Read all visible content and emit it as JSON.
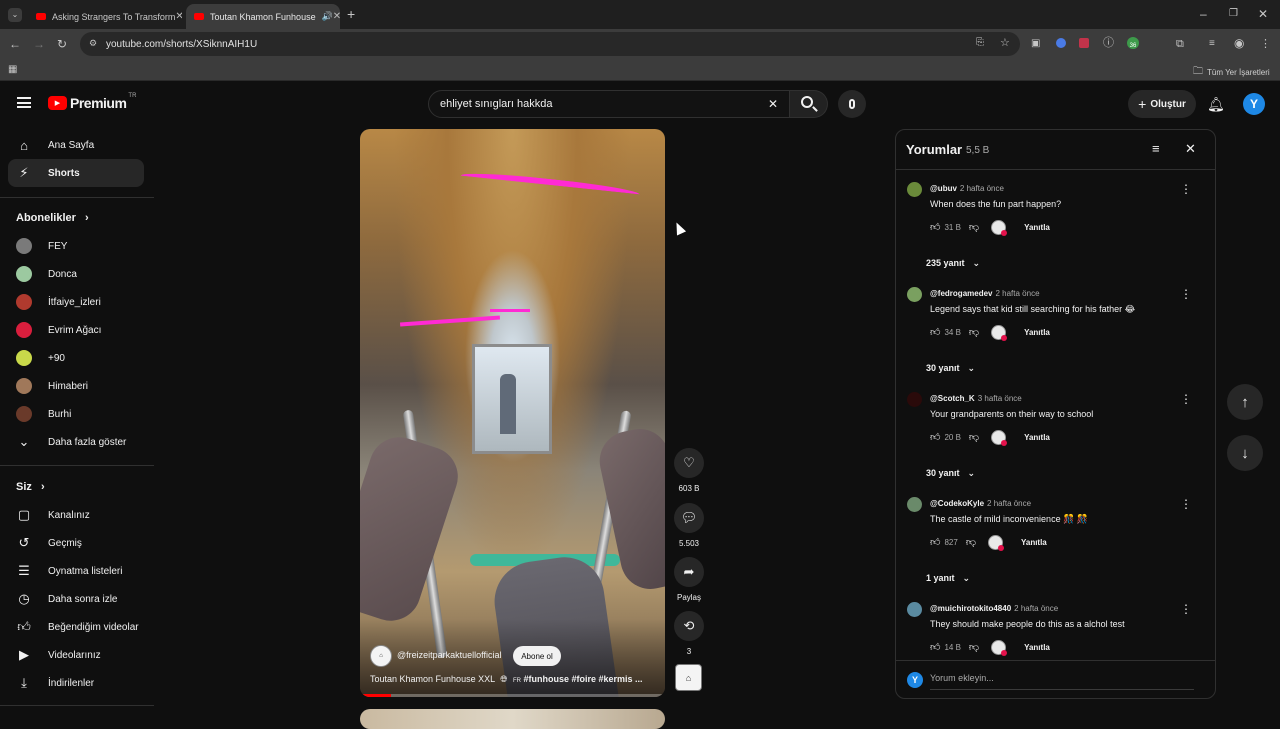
{
  "browser": {
    "tabs": [
      {
        "title": "Asking Strangers To Transform"
      },
      {
        "title": "Toutan Khamon Funhouse"
      }
    ],
    "url": "youtube.com/shorts/XSiknnAIH1U",
    "bookmarks_folder": "Tüm Yer İşaretleri",
    "extension_badge": "36"
  },
  "header": {
    "logo_text": "Premium",
    "logo_suffix": "TR",
    "search_value": "ehliyet sınıgları hakkda",
    "create_label": "Oluştur",
    "user_initial": "Y"
  },
  "sidebar": {
    "home": "Ana Sayfa",
    "shorts": "Shorts",
    "subs_heading": "Abonelikler",
    "subscriptions": [
      {
        "name": "FEY",
        "color": "#7a7a7a"
      },
      {
        "name": "Donca",
        "color": "#9cc9a0"
      },
      {
        "name": "İtfaiye_izleri",
        "color": "#b03a2e"
      },
      {
        "name": "Evrim Ağacı",
        "color": "#d91e3d"
      },
      {
        "name": "+90",
        "color": "#c9d94a"
      },
      {
        "name": "Himaberi",
        "color": "#a0785a"
      },
      {
        "name": "Burhi",
        "color": "#6a3a2a"
      }
    ],
    "show_more": "Daha fazla göster",
    "you_heading": "Siz",
    "you_items": [
      {
        "label": "Kanalınız",
        "icon": "channel-icon"
      },
      {
        "label": "Geçmiş",
        "icon": "history-icon"
      },
      {
        "label": "Oynatma listeleri",
        "icon": "playlists-icon"
      },
      {
        "label": "Daha sonra izle",
        "icon": "watch-later-icon"
      },
      {
        "label": "Beğendiğim videolar",
        "icon": "liked-icon"
      },
      {
        "label": "Videolarınız",
        "icon": "your-videos-icon"
      },
      {
        "label": "İndirilenler",
        "icon": "downloads-icon"
      }
    ]
  },
  "short": {
    "channel": "@freizeitparkaktuellofficial",
    "subscribe": "Abone ol",
    "title": "Toutan Khamon Funhouse XXL",
    "title_tags": "#funhouse #foire #kermis ...",
    "flag_code": "FR",
    "likes": "603 B",
    "comments": "5.503",
    "share": "Paylaş",
    "remix": "3"
  },
  "comments_panel": {
    "title": "Yorumlar",
    "count": "5,5 B",
    "add_placeholder": "Yorum ekleyin...",
    "reply_label": "Yanıtla",
    "items": [
      {
        "author": "@ubuv",
        "time": "2 hafta önce",
        "text": "When does the fun part happen?",
        "likes": "31 B",
        "replies": "235 yanıt",
        "avatar_color": "#6a8a3a"
      },
      {
        "author": "@fedrogamedev",
        "time": "2 hafta önce",
        "text": "Legend says that kid still searching for his father 😂",
        "likes": "34 B",
        "replies": "30 yanıt",
        "avatar_color": "#7aa060"
      },
      {
        "author": "@Scotch_K",
        "time": "3 hafta önce",
        "text": "Your grandparents on their way to school",
        "likes": "20 B",
        "replies": "30 yanıt",
        "avatar_color": "#2a0a0a"
      },
      {
        "author": "@CodekoKyle",
        "time": "2 hafta önce",
        "text": "The castle of mild inconvenience 🎊 🎊",
        "likes": "827",
        "replies": "1 yanıt",
        "avatar_color": "#6a8a6a"
      },
      {
        "author": "@muichirotokito4840",
        "time": "2 hafta önce",
        "text": "They should make people do this as a alchol test",
        "likes": "14 B",
        "replies": "",
        "avatar_color": "#5a8aa0"
      }
    ]
  }
}
